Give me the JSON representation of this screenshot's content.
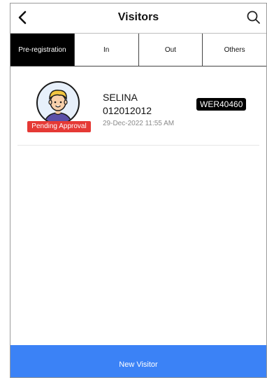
{
  "header": {
    "title": "Visitors",
    "back_icon": "chevron-left-icon",
    "search_icon": "search-icon"
  },
  "tabs": [
    {
      "label": "Pre-registration",
      "active": true
    },
    {
      "label": "In",
      "active": false
    },
    {
      "label": "Out",
      "active": false
    },
    {
      "label": "Others",
      "active": false
    }
  ],
  "visitor": {
    "name": "SELINA",
    "phone": "012012012",
    "datetime": "29-Dec-2022 11:55 AM",
    "status": "Pending Approval",
    "plate": "WER40460",
    "avatar_icon": "avatar-illustration"
  },
  "footer": {
    "new_visitor_label": "New Visitor"
  },
  "colors": {
    "accent": "#3b82f6",
    "status_pending": "#e53935",
    "active_tab_bg": "#000000"
  }
}
